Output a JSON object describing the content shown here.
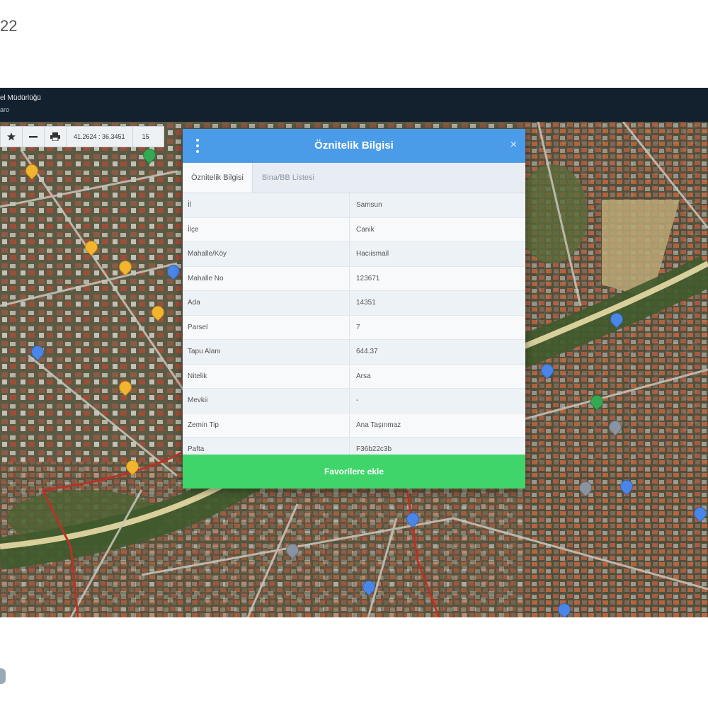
{
  "page": {
    "corner_text": "22"
  },
  "topbar": {
    "title": "el Müdürlüğü",
    "subtitle": "aro"
  },
  "toolbar": {
    "coordinates": "41.2624 : 36.3451",
    "zoom": "15",
    "icons": [
      "star-icon",
      "minus-icon",
      "print-icon"
    ]
  },
  "dialog": {
    "title": "Öznitelik Bilgisi",
    "close_label": "×",
    "tabs": [
      {
        "label": "Öznitelik Bilgisi",
        "active": true
      },
      {
        "label": "Bina/BB Listesi",
        "active": false
      }
    ],
    "rows": [
      {
        "key": "İl",
        "value": "Samsun"
      },
      {
        "key": "İlçe",
        "value": "Canik"
      },
      {
        "key": "Mahalle/Köy",
        "value": "Hacıismail"
      },
      {
        "key": "Mahalle No",
        "value": "123671"
      },
      {
        "key": "Ada",
        "value": "14351"
      },
      {
        "key": "Parsel",
        "value": "7"
      },
      {
        "key": "Tapu Alanı",
        "value": "644.37"
      },
      {
        "key": "Nitelik",
        "value": "Arsa"
      },
      {
        "key": "Mevkii",
        "value": "-"
      },
      {
        "key": "Zemin Tip",
        "value": "Ana Taşınmaz"
      },
      {
        "key": "Pafta",
        "value": "F36b22c3b"
      }
    ],
    "favorite_button": "Favorilere ekle"
  },
  "colors": {
    "header_blue": "#4a9be8",
    "favorite_green": "#3fd56a",
    "topbar_dark": "#13202e"
  }
}
